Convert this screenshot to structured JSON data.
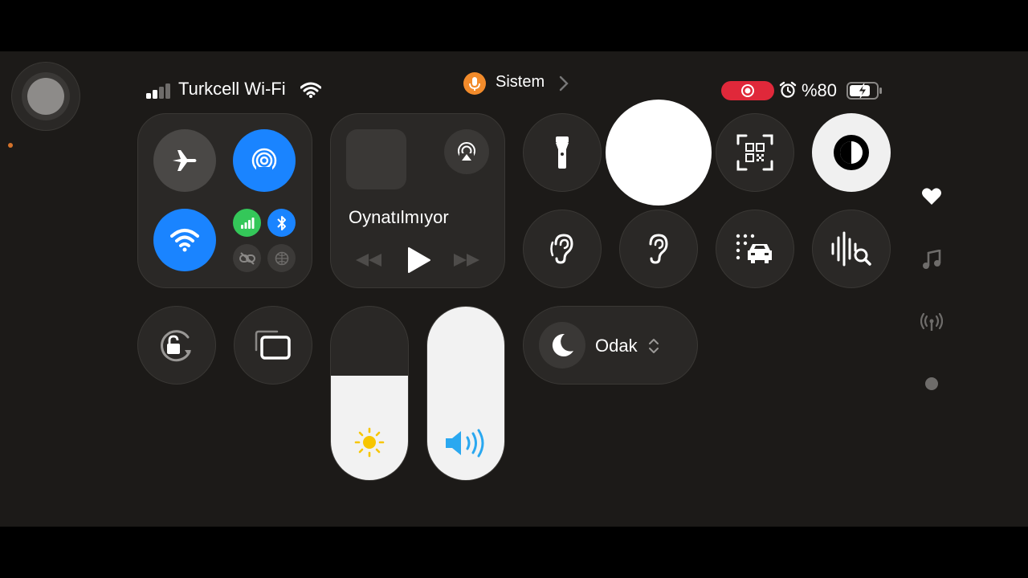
{
  "status_bar": {
    "carrier": "Turkcell Wi-Fi",
    "wifi_icon": "wifi-icon",
    "focus_source": "Sistem",
    "battery_percent": "%80",
    "recording_color": "#e0283a",
    "mic_color": "#f28b2b"
  },
  "connectivity": {
    "airplane": "airplane-icon",
    "airdrop": "airdrop-icon",
    "wifi": "wifi-icon",
    "cellular": "cellular-icon",
    "bluetooth": "bluetooth-icon",
    "accent": "#1a84ff",
    "cellular_color": "#34c759"
  },
  "now_playing": {
    "title": "Oynatılmıyor"
  },
  "focus": {
    "label": "Odak"
  },
  "sliders": {
    "brightness": 0.6,
    "volume": 1.0
  }
}
